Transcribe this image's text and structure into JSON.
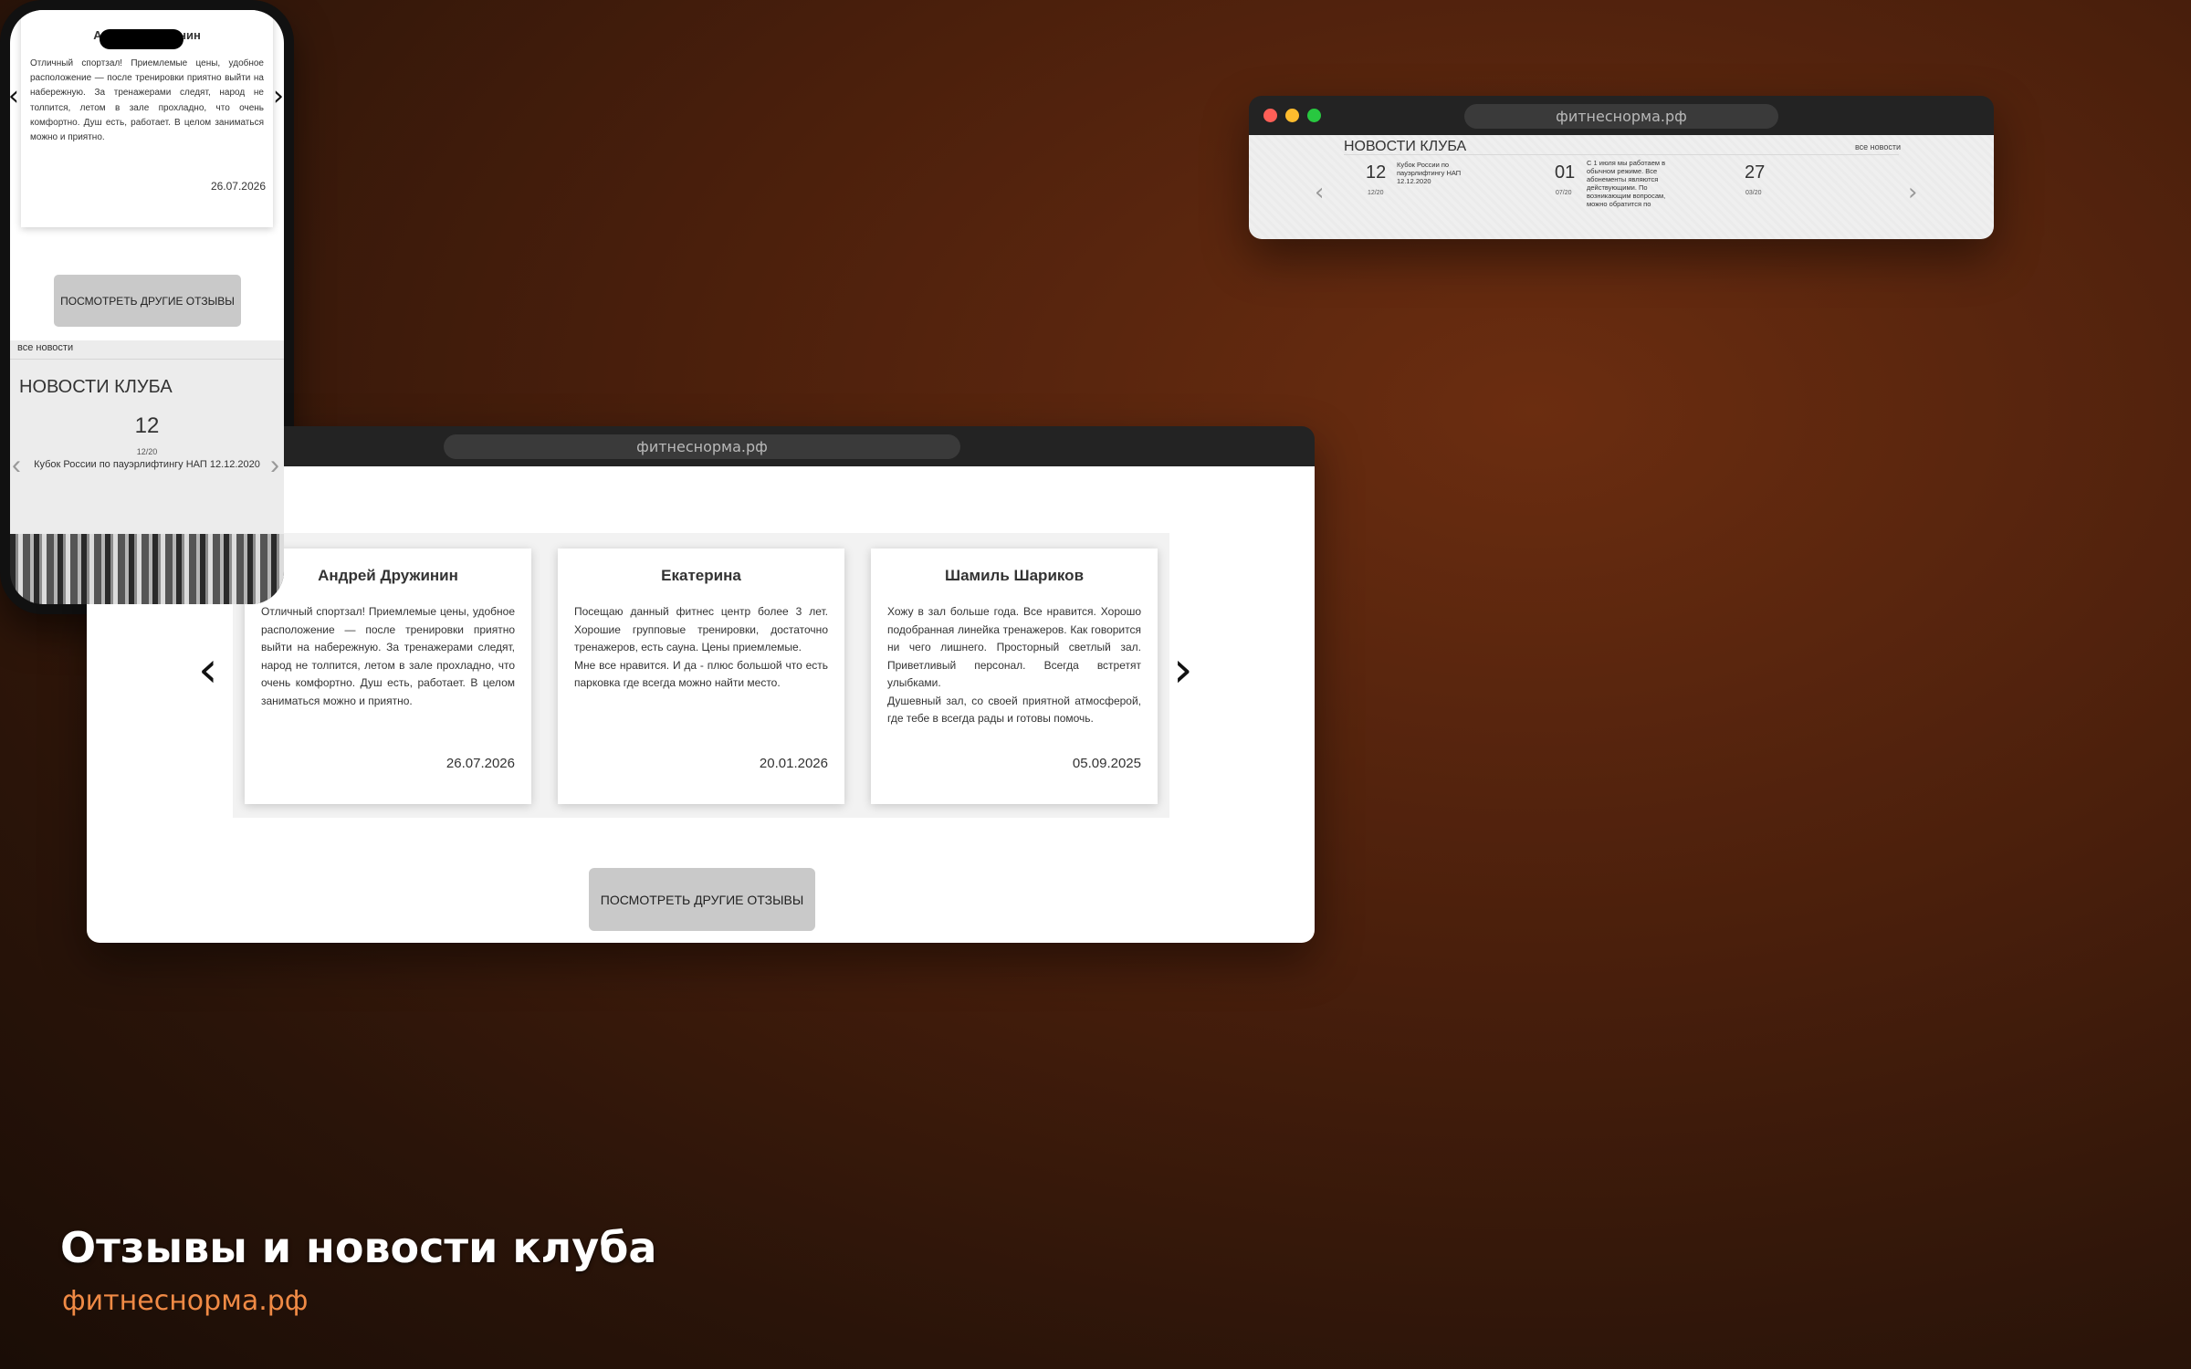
{
  "domain_url": "фитнесնорма.рф",
  "browser": {
    "url": "фитнеснорма.рф"
  },
  "reviews": {
    "items": [
      {
        "name": "Андрей Дружинин",
        "text": "Отличный спортзал! Приемлемые цены, удобное расположение — после тренировки приятно выйти на набережную. За тренажерами следят, народ не толпится, летом в зале прохладно, что очень комфортно. Душ есть, работает. В целом заниматься можно и приятно.",
        "date": "26.07.2026"
      },
      {
        "name": "Екатерина",
        "text": "Посещаю данный фитнес центр более 3 лет. Хорошие групповые тренировки, достаточно тренажеров, есть сауна. Цены приемлемые.\nМне все нравится. И да - плюс большой что есть парковка где всегда можно найти место.",
        "date": "20.01.2026"
      },
      {
        "name": "Шамиль Шариков",
        "text": "Хожу в зал больше года. Все нравится. Хорошо подобранная линейка тренажеров. Как говорится ни чего лишнего. Просторный светлый зал. Приветливый персонал. Всегда встретят улыбками.\nДушевный зал, со своей приятной атмосферой, где тебе в всегда рады и готовы помочь.",
        "date": "05.09.2025"
      }
    ],
    "more_button": "ПОСМОТРЕТЬ ДРУГИЕ ОТЗЫВЫ",
    "prev_glyph": "‹",
    "next_glyph": "›"
  },
  "news": {
    "title": "НОВОСТИ КЛУБА",
    "all_link": "все новости",
    "items": [
      {
        "day": "12",
        "month_year": "12/20",
        "text": "Кубок России по пауэрлифтингу НАП 12.12.2020"
      },
      {
        "day": "01",
        "month_year": "07/20",
        "text": "С 1 июля мы работаем в обычном режиме. Все абонементы являются действующими. По возникающим вопросам, можно обратится по"
      },
      {
        "day": "27",
        "month_year": "03/20",
        "text": ""
      }
    ]
  },
  "phone": {
    "review": {
      "name": "Андрей Дружинин",
      "text": "Отличный спортзал! Приемлемые цены, удобное расположение — после тренировки приятно выйти на набережную. За тренажерами следят, народ не толпится, летом в зале прохладно, что очень комфортно. Душ есть, работает. В целом заниматься можно и приятно.",
      "date": "26.07.2026"
    },
    "more_button": "ПОСМОТРЕТЬ ДРУГИЕ ОТЗЫВЫ",
    "news_all": "все новости",
    "news_title": "НОВОСТИ КЛУБА",
    "news_day": "12",
    "news_month_year": "12/20",
    "news_text": "Кубок России по пауэрлифтингу НАП 12.12.2020"
  },
  "caption": {
    "title": "Отзывы и новости клуба",
    "subtitle": "фитнеснорма.рф"
  },
  "colors": {
    "accent": "#f08a45",
    "button_bg": "#c9c9c9",
    "titlebar": "#232323"
  }
}
